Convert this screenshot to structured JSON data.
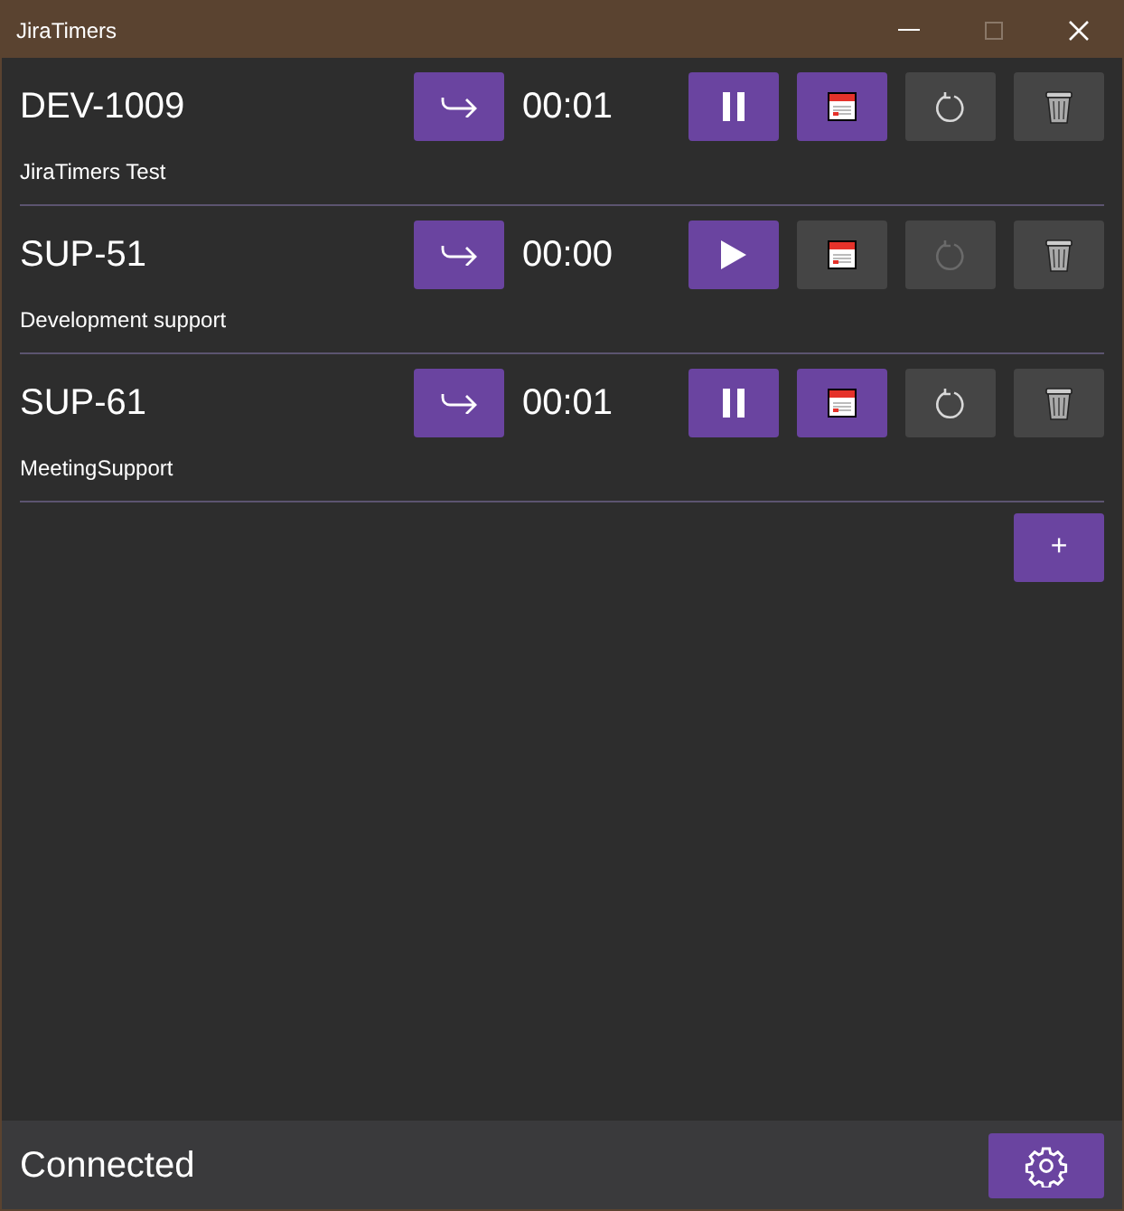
{
  "window": {
    "title": "JiraTimers"
  },
  "timers": [
    {
      "key": "DEV-1009",
      "summary": "JiraTimers Test",
      "time": "00:01",
      "running": true,
      "reset_disabled": false
    },
    {
      "key": "SUP-51",
      "summary": "Development support",
      "time": "00:00",
      "running": false,
      "reset_disabled": true
    },
    {
      "key": "SUP-61",
      "summary": "MeetingSupport",
      "time": "00:01",
      "running": true,
      "reset_disabled": false
    }
  ],
  "add_button": "+",
  "status_bar": {
    "status": "Connected"
  }
}
